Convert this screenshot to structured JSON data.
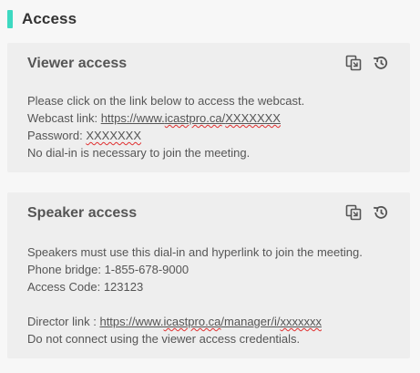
{
  "section": {
    "title": "Access",
    "accent_color": "#3dd9c1"
  },
  "viewer": {
    "title": "Viewer access",
    "copy_icon": "copy-icon",
    "history_icon": "history-icon",
    "line1": "Please click on the link below to access the webcast.",
    "webcast_label": "Webcast link: ",
    "webcast_url_prefix": "https://www.",
    "webcast_url_domain": "icastpro.ca",
    "webcast_url_slash": "/",
    "webcast_url_code": "XXXXXXX",
    "password_label": "Password: ",
    "password_value": "XXXXXXX",
    "line4": "No dial-in is necessary to join the meeting."
  },
  "speaker": {
    "title": "Speaker access",
    "copy_icon": "copy-icon",
    "history_icon": "history-icon",
    "line1": "Speakers must use this dial-in and hyperlink to join the meeting.",
    "phone_line": "Phone bridge: 1-855-678-9000",
    "access_line": "Access Code: 123123",
    "director_label": "Director link : ",
    "director_url_prefix": "https://www.",
    "director_url_domain": "icastpro.ca",
    "director_url_path": "/manager/i/",
    "director_url_code": "xxxxxxx",
    "last_line": "Do not connect using the viewer access credentials."
  }
}
